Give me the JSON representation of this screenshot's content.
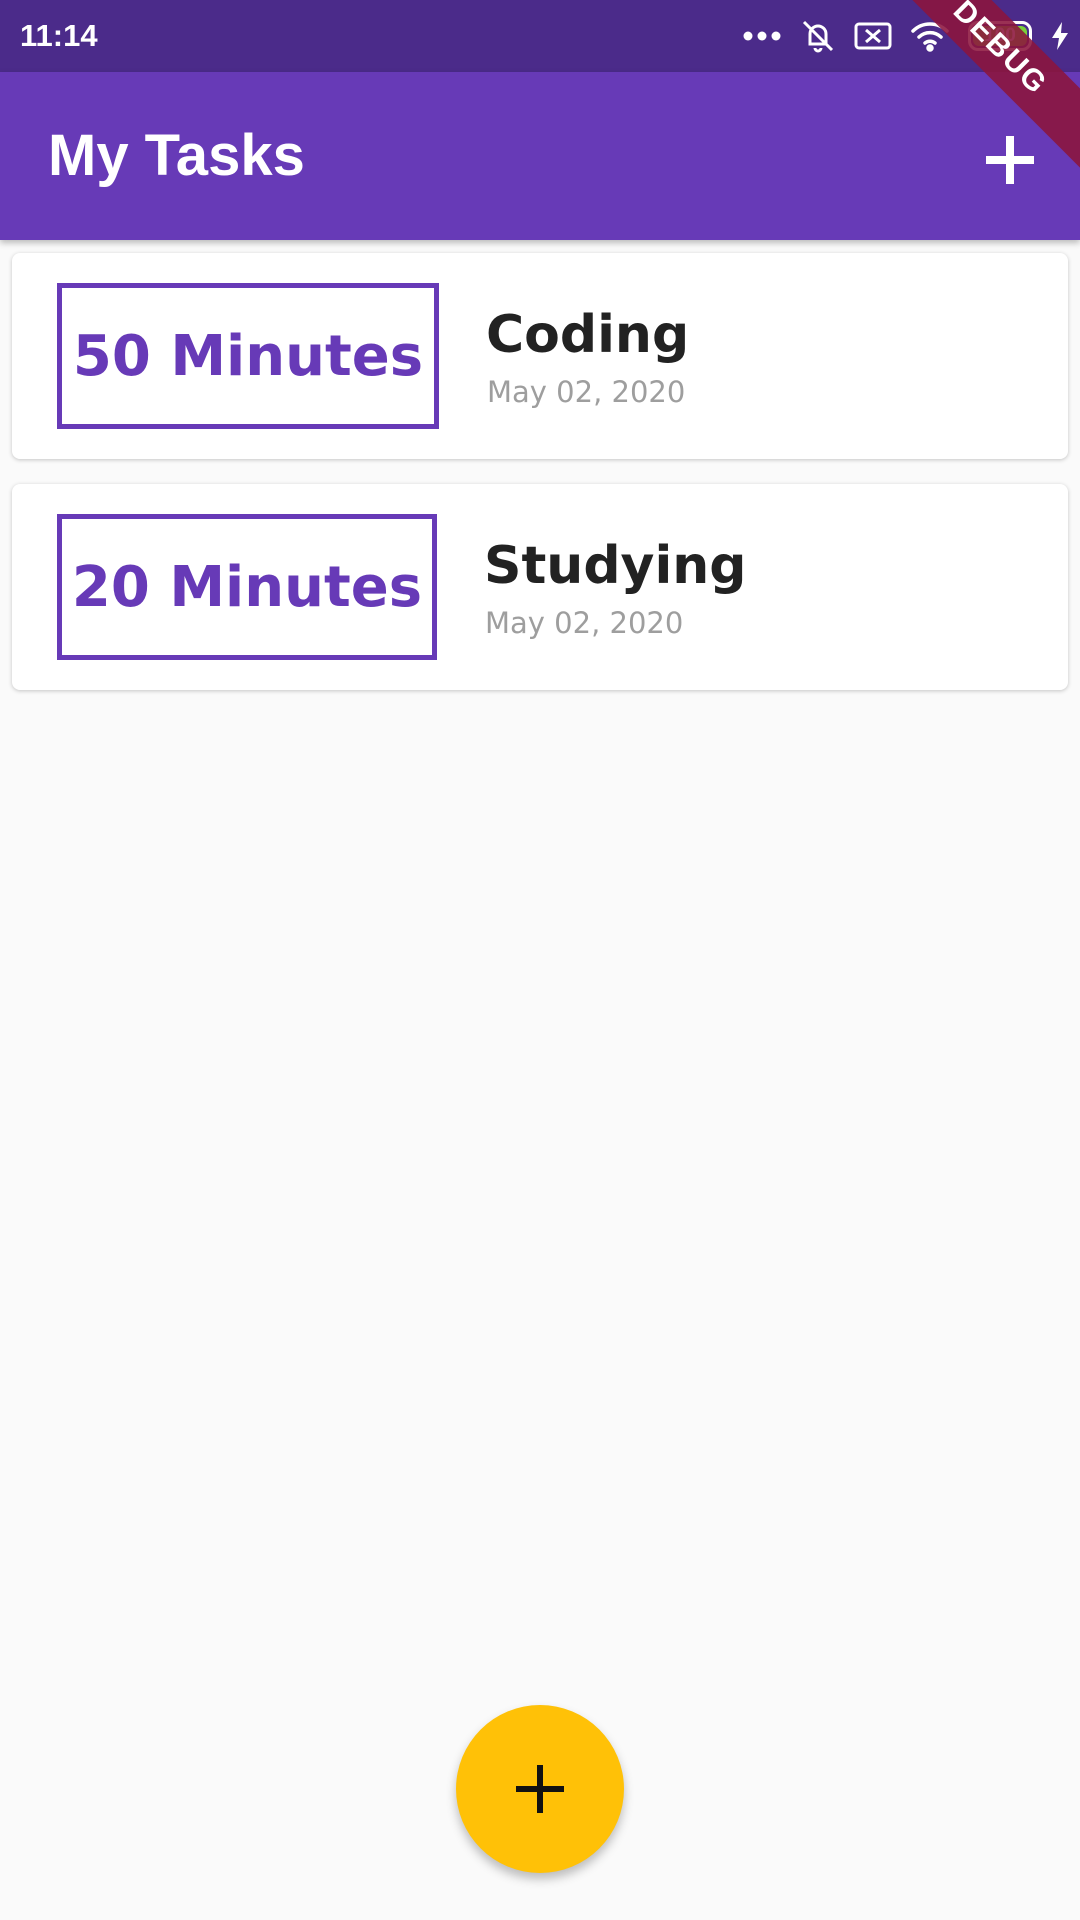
{
  "status_bar": {
    "time": "11:14",
    "battery_level": "100",
    "icons": [
      "more-dots-icon",
      "bell-off-icon",
      "sim-x-icon",
      "wifi-icon",
      "battery-icon",
      "charging-bolt-icon"
    ]
  },
  "app_bar": {
    "title": "My Tasks",
    "add_icon": "plus-icon"
  },
  "debug_banner": "DEBUG",
  "tasks": [
    {
      "duration": "50 Minutes",
      "title": "Coding",
      "date": "May 02, 2020"
    },
    {
      "duration": "20 Minutes",
      "title": "Studying",
      "date": "May 02, 2020"
    }
  ],
  "fab": {
    "icon": "plus-icon"
  },
  "colors": {
    "primary": "#673ab7",
    "status_bar": "#4b2b8a",
    "fab": "#ffc107",
    "background": "#fafafa"
  }
}
